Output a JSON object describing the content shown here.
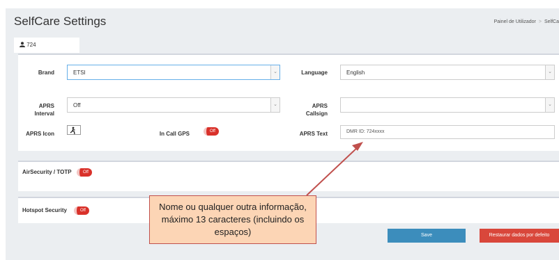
{
  "header": {
    "title": "SelfCare Settings",
    "breadcrumb": [
      "Painel de Utilizador",
      "SelfCa"
    ]
  },
  "tab": {
    "label": "724"
  },
  "form": {
    "brand_label": "Brand",
    "brand_value": "ETSI",
    "language_label": "Language",
    "language_value": "English",
    "aprs_interval_label": "APRS Interval",
    "aprs_interval_value": "Off",
    "aprs_callsign_label": "APRS Callsign",
    "aprs_callsign_value": "",
    "aprs_icon_label": "APRS Icon",
    "in_call_gps_label": "In Call GPS",
    "in_call_gps_state": "Off",
    "aprs_text_label": "APRS Text",
    "aprs_text_value": "DMR ID: 724xxxx"
  },
  "air_security": {
    "label": "AirSecurity / TOTP",
    "state": "Off"
  },
  "hotspot_security": {
    "label": "Hotspot Security",
    "state": "Off"
  },
  "buttons": {
    "save": "Save",
    "restore": "Restaurar dados por defeito"
  },
  "callout": {
    "text": "Nome ou qualquer outra informação, máximo 13 caracteres (incluindo os espaços)"
  },
  "colors": {
    "primary": "#3c8dbc",
    "danger": "#d9473b",
    "toggle_off": "#d9312a",
    "callout_fill": "#fcd5b5",
    "callout_border": "#c0504d"
  }
}
